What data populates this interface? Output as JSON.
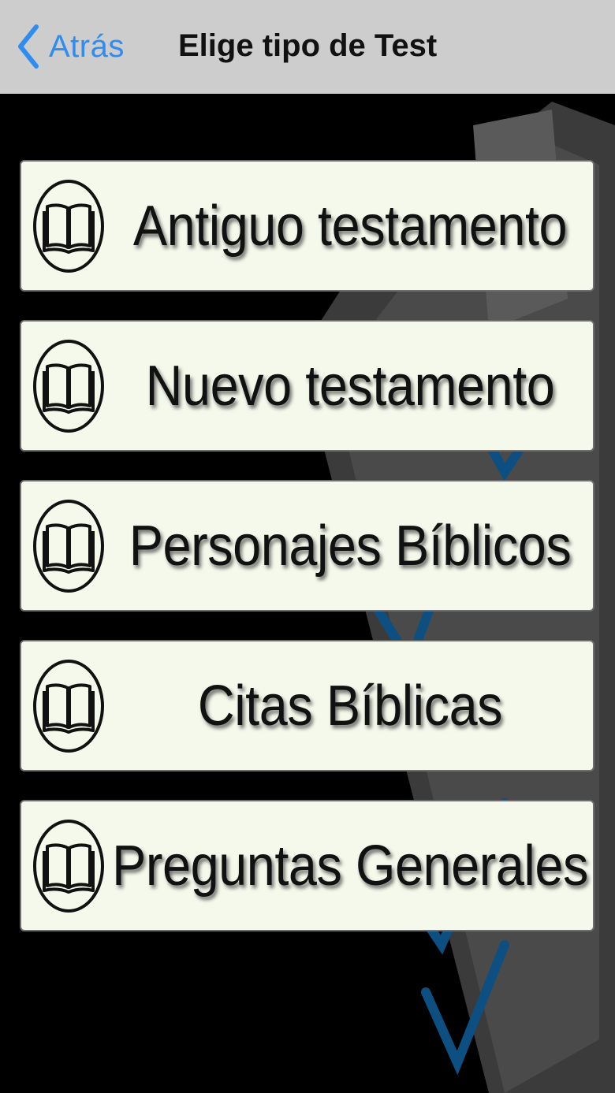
{
  "navbar": {
    "back_label": "Atrás",
    "title": "Elige tipo de Test"
  },
  "menu": {
    "items": [
      {
        "label": "Antiguo testamento",
        "icon": "open-book-icon"
      },
      {
        "label": "Nuevo testamento",
        "icon": "open-book-icon"
      },
      {
        "label": "Personajes Bíblicos",
        "icon": "open-book-icon"
      },
      {
        "label": "Citas Bíblicas",
        "icon": "open-book-icon"
      },
      {
        "label": "Preguntas Generales",
        "icon": "open-book-icon"
      }
    ]
  },
  "colors": {
    "navbar_bg": "#cdcdcd",
    "back_link": "#2f8cf0",
    "button_bg": "#f5f9ec",
    "background": "#000000",
    "checkmark": "#0d4f80"
  }
}
